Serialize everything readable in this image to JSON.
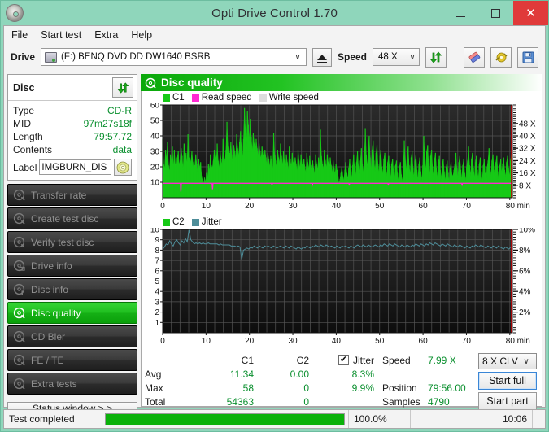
{
  "window": {
    "title": "Opti Drive Control 1.70",
    "app_icon": "disc-icon",
    "minimize": "–",
    "maximize": "□",
    "close": "✕"
  },
  "menu": {
    "items": [
      {
        "label": "File"
      },
      {
        "label": "Start test"
      },
      {
        "label": "Extra"
      },
      {
        "label": "Help"
      }
    ]
  },
  "toolbar": {
    "drive_label": "Drive",
    "drive_value": "(F:)   BENQ DVD DD DW1640 BSRB",
    "eject_icon": "eject-icon",
    "speed_label": "Speed",
    "speed_value": "48 X",
    "refresh_icon": "refresh-icon",
    "eraser_icon": "eraser-icon",
    "tools_icon": "tools-icon",
    "save_icon": "save-icon",
    "caret": "∨"
  },
  "disc_panel": {
    "title": "Disc",
    "refresh_icon": "refresh-icon",
    "rows": [
      {
        "label": "Type",
        "value": "CD-R"
      },
      {
        "label": "MID",
        "value": "97m27s18f"
      },
      {
        "label": "Length",
        "value": "79:57.72"
      },
      {
        "label": "Contents",
        "value": "data"
      }
    ],
    "label_field": {
      "label": "Label",
      "value": "IMGBURN_DIS",
      "button_icon": "cd-icon"
    }
  },
  "sidebar": {
    "items": [
      {
        "label": "Transfer rate",
        "icon": "disc-test-icon",
        "active": false
      },
      {
        "label": "Create test disc",
        "icon": "disc-create-icon",
        "active": false
      },
      {
        "label": "Verify test disc",
        "icon": "disc-verify-icon",
        "active": false
      },
      {
        "label": "Drive info",
        "icon": "drive-info-icon",
        "active": false
      },
      {
        "label": "Disc info",
        "icon": "disc-info-icon",
        "active": false
      },
      {
        "label": "Disc quality",
        "icon": "disc-quality-icon",
        "active": true
      },
      {
        "label": "CD Bler",
        "icon": "cd-bler-icon",
        "active": false
      },
      {
        "label": "FE / TE",
        "icon": "fe-te-icon",
        "active": false
      },
      {
        "label": "Extra tests",
        "icon": "extra-tests-icon",
        "active": false
      }
    ],
    "status_window_button": "Status window > >"
  },
  "panel": {
    "title": "Disc quality",
    "icon": "disc-quality-icon"
  },
  "stats": {
    "headers": {
      "c1": "C1",
      "c2": "C2",
      "jitter": "Jitter"
    },
    "jitter_checked": true,
    "check_glyph": "✔",
    "rows": [
      {
        "label": "Avg",
        "c1": "11.34",
        "c2": "0.00",
        "jitter": "8.3%"
      },
      {
        "label": "Max",
        "c1": "58",
        "c2": "0",
        "jitter": "9.9%"
      },
      {
        "label": "Total",
        "c1": "54363",
        "c2": "0",
        "jitter": ""
      }
    ],
    "speed_label": "Speed",
    "speed_value": "7.99 X",
    "position_label": "Position",
    "position_value": "79:56.00",
    "samples_label": "Samples",
    "samples_value": "4790",
    "write_strategy": "8 X CLV",
    "caret": "∨",
    "start_full": "Start full",
    "start_part": "Start part"
  },
  "statusbar": {
    "text": "Test completed",
    "progress_percent": 100,
    "percent_label": "100.0%",
    "elapsed": "10:06"
  },
  "chart_data": [
    {
      "type": "area",
      "name": "c1-chart",
      "title": "",
      "xlabel": "min",
      "ylabel": "",
      "xlim": [
        0,
        80.6
      ],
      "ylim": [
        0,
        60
      ],
      "xticks": [
        0,
        10,
        20,
        30,
        40,
        50,
        60,
        70,
        80
      ],
      "xticklabels": [
        "0",
        "10",
        "20",
        "30",
        "40",
        "50",
        "60",
        "70",
        "80 min"
      ],
      "yticks": [
        10,
        20,
        30,
        40,
        50,
        60
      ],
      "yticklabels": [
        "10",
        "20",
        "30",
        "40",
        "50",
        "60"
      ],
      "right_axis": {
        "label": "X",
        "ticks": [
          8,
          16,
          24,
          32,
          40,
          48
        ],
        "ticklabels": [
          "8 X",
          "16 X",
          "24 X",
          "32 X",
          "40 X",
          "48 X"
        ],
        "ylim": [
          0,
          60
        ]
      },
      "grid": true,
      "legend": [
        {
          "label": "C1",
          "color": "#16c916"
        },
        {
          "label": "Read speed",
          "color": "#ff28d2"
        },
        {
          "label": "Write speed",
          "color": "#dcdcdc"
        }
      ],
      "series": [
        {
          "name": "C1",
          "color": "#16c916",
          "values": [
            38,
            22,
            19,
            31,
            25,
            36,
            21,
            17,
            28,
            23,
            33,
            20,
            31,
            22,
            18,
            26,
            30,
            21,
            24,
            32,
            27,
            18,
            35,
            23,
            29,
            22,
            41,
            26,
            19,
            24,
            30,
            23,
            17,
            21,
            28,
            22,
            16,
            25,
            19,
            23,
            14,
            11,
            9,
            13,
            10,
            16,
            12,
            22,
            17,
            28,
            21,
            19,
            24,
            31,
            26,
            22,
            35,
            24,
            19,
            30,
            25,
            21,
            38,
            27,
            23,
            31,
            49,
            33,
            24,
            29,
            36,
            28,
            22,
            34,
            30,
            25,
            41,
            32,
            27,
            36,
            43,
            31,
            26,
            38,
            58,
            44,
            33,
            56,
            47,
            36,
            51,
            39,
            30,
            42,
            35,
            29,
            38,
            32,
            27,
            35,
            30,
            25,
            33,
            28,
            22,
            31,
            26,
            21,
            29,
            25,
            20,
            27,
            23,
            18,
            42,
            28,
            24,
            19,
            31,
            26,
            22,
            35,
            27,
            21,
            30,
            24,
            19,
            28,
            23,
            18,
            33,
            25,
            20,
            29,
            23,
            19,
            26,
            22,
            17,
            31,
            24,
            19,
            28,
            22,
            18,
            25,
            20,
            16,
            29,
            23,
            18,
            27,
            21,
            17,
            24,
            19,
            15,
            28,
            22,
            18,
            26,
            21,
            44,
            27,
            22,
            18,
            31,
            24,
            19,
            28,
            23,
            18,
            26,
            21,
            16,
            24,
            19,
            15,
            22,
            18,
            14,
            9,
            12,
            16,
            20,
            14,
            11,
            18,
            23,
            16,
            12,
            19,
            25,
            17,
            13,
            21,
            28,
            19,
            14,
            23,
            30,
            20,
            15,
            24,
            32,
            22,
            16,
            26,
            45,
            28,
            19,
            33,
            40,
            26,
            18,
            31,
            37,
            24,
            17,
            29,
            34,
            22,
            16,
            27,
            31,
            20,
            15,
            25,
            29,
            19,
            14,
            23,
            27,
            18,
            13,
            22,
            25,
            17,
            12,
            21,
            24,
            16,
            11,
            20,
            23,
            15,
            10,
            19,
            37,
            24,
            17,
            29,
            33,
            21,
            15,
            26,
            30,
            19,
            13,
            24,
            28,
            18,
            12,
            22,
            26,
            17,
            11,
            21,
            40,
            25,
            18,
            30,
            34,
            22,
            15,
            27,
            31,
            20,
            14,
            25,
            29,
            19,
            13,
            23,
            27,
            18,
            12,
            22,
            25,
            17,
            11,
            20,
            24,
            16,
            10,
            19,
            23,
            15,
            14,
            18,
            22,
            29,
            19,
            13,
            23,
            27,
            18,
            12,
            21,
            25,
            16,
            11,
            20,
            24,
            33,
            21,
            14,
            25,
            29,
            19,
            13,
            23,
            27,
            18,
            12,
            22,
            26,
            17,
            11,
            21,
            25,
            16,
            10,
            20,
            24,
            32,
            20,
            14,
            24,
            28,
            18,
            12,
            23,
            27,
            17,
            11,
            21,
            25,
            16,
            22,
            26,
            18,
            13,
            23,
            27,
            19,
            14,
            24,
            28,
            20
          ]
        },
        {
          "name": "Read speed",
          "color": "#ff28d2",
          "constant": 9.3,
          "dips": [
            {
              "x": 4.2,
              "y": 4.0
            },
            {
              "x": 11.5,
              "y": 5.5
            },
            {
              "x": 25.2,
              "y": 8.2
            },
            {
              "x": 34.5,
              "y": 8.2
            },
            {
              "x": 43.0,
              "y": 8.5
            },
            {
              "x": 52.0,
              "y": 8.5
            },
            {
              "x": 69.0,
              "y": 8.3
            }
          ]
        }
      ]
    },
    {
      "type": "line",
      "name": "c2-jitter-chart",
      "title": "",
      "xlabel": "min",
      "ylabel": "",
      "xlim": [
        0,
        80.6
      ],
      "ylim": [
        0,
        10
      ],
      "xticks": [
        0,
        10,
        20,
        30,
        40,
        50,
        60,
        70,
        80
      ],
      "xticklabels": [
        "0",
        "10",
        "20",
        "30",
        "40",
        "50",
        "60",
        "70",
        "80 min"
      ],
      "yticks": [
        1,
        2,
        3,
        4,
        5,
        6,
        7,
        8,
        9,
        10
      ],
      "yticklabels": [
        "1",
        "2",
        "3",
        "4",
        "5",
        "6",
        "7",
        "8",
        "9",
        "10"
      ],
      "right_axis": {
        "label": "%",
        "ticks": [
          2,
          4,
          6,
          8,
          10
        ],
        "ticklabels": [
          "2%",
          "4%",
          "6%",
          "8%",
          "10%"
        ],
        "ylim": [
          0,
          10
        ]
      },
      "grid": true,
      "legend": [
        {
          "label": "C2",
          "color": "#16c916"
        },
        {
          "label": "Jitter",
          "color": "#4e8d99"
        }
      ],
      "series": [
        {
          "name": "Jitter",
          "color": "#4e8d99",
          "values": [
            8.1,
            8.3,
            8.6,
            8.5,
            8.9,
            8.6,
            8.4,
            8.8,
            9.0,
            8.7,
            8.5,
            8.9,
            8.7,
            9.1,
            8.8,
            10.0,
            9.0,
            8.8,
            8.6,
            8.7,
            8.6,
            8.7,
            8.6,
            8.7,
            8.6,
            8.6,
            8.7,
            8.6,
            8.6,
            8.6,
            8.6,
            8.6,
            8.5,
            8.6,
            8.5,
            8.5,
            8.5,
            8.5,
            8.5,
            8.4,
            8.4,
            8.4,
            8.3,
            8.4,
            8.3,
            7.1,
            8.0,
            8.1,
            8.2,
            8.1,
            8.3,
            8.2,
            8.4,
            8.3,
            8.2,
            8.4,
            8.3,
            8.2,
            8.4,
            8.3,
            8.4,
            8.3,
            8.2,
            8.4,
            8.3,
            8.2,
            8.3,
            8.4,
            8.3,
            8.2,
            8.4,
            8.3,
            8.2,
            8.4,
            8.3,
            8.2,
            8.1,
            8.3,
            8.2,
            8.1,
            8.3,
            8.2,
            8.4,
            8.3,
            8.2,
            8.4,
            8.3,
            8.5,
            8.4,
            8.3,
            8.5,
            8.4,
            8.3,
            8.5,
            8.4,
            8.3,
            8.4,
            8.3,
            8.2,
            8.4,
            8.3,
            8.2,
            8.4,
            8.3,
            8.4,
            8.3,
            8.2,
            8.4,
            8.3,
            8.2,
            8.4,
            8.5,
            8.4,
            8.3,
            8.5,
            8.4,
            8.3,
            8.5,
            8.4,
            8.3,
            8.4,
            8.5,
            8.4,
            8.3,
            8.5,
            8.4,
            8.6,
            8.5,
            8.4,
            8.6,
            8.5,
            8.4,
            8.6,
            8.5,
            8.4,
            8.3,
            8.5,
            8.4,
            8.3,
            8.5,
            8.4,
            8.3,
            8.5,
            8.4,
            8.6,
            8.5,
            8.4,
            8.6,
            8.5,
            8.4,
            8.6,
            8.5,
            8.7,
            8.6,
            8.5,
            8.7,
            8.6,
            8.5,
            8.4,
            8.6,
            8.5,
            8.4,
            8.6,
            8.5,
            8.4,
            8.3,
            8.5,
            8.4,
            8.3,
            8.5,
            8.4,
            8.3,
            8.2,
            8.4,
            8.3,
            8.2,
            8.4,
            8.3,
            8.5,
            8.4,
            8.3,
            8.5,
            8.4,
            8.3,
            8.2,
            8.4,
            8.3,
            8.2,
            8.4,
            8.3,
            8.2,
            8.4,
            8.3,
            8.2,
            8.1,
            8.3,
            8.2,
            8.1,
            8.3,
            8.2
          ]
        }
      ]
    }
  ]
}
